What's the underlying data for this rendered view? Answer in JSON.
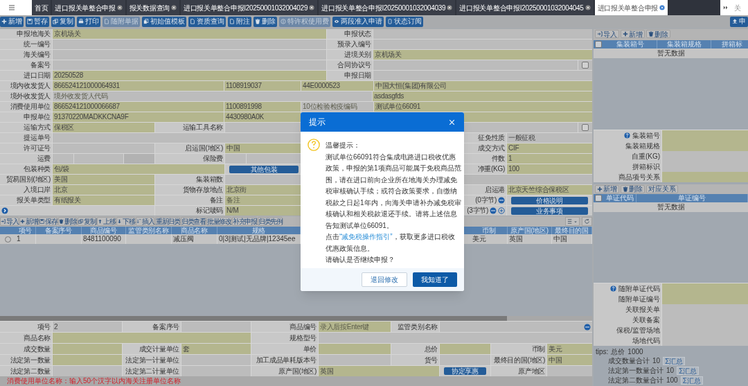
{
  "tabs": [
    {
      "label": "首页",
      "selected": false,
      "closable": false
    },
    {
      "label": "进口报关单整合申报",
      "selected": false,
      "closable": true
    },
    {
      "label": "报关数据查询",
      "selected": false,
      "closable": true
    },
    {
      "label": "进口报关单整合申报I20250001032004029",
      "selected": false,
      "closable": true
    },
    {
      "label": "进口报关单整合申报I20250001032004039",
      "selected": false,
      "closable": true
    },
    {
      "label": "进口报关单整合申报I20250001032004045",
      "selected": false,
      "closable": true
    },
    {
      "label": "进口报关单整合申报",
      "selected": true,
      "closable": true
    }
  ],
  "tab_overflow": {
    "label": "关"
  },
  "toolbar": [
    {
      "label": "新增",
      "disabled": false
    },
    {
      "label": "暂存",
      "disabled": false
    },
    {
      "label": "复制",
      "disabled": false
    },
    {
      "label": "打印",
      "disabled": false
    },
    {
      "label": "随附单据",
      "disabled": true
    },
    {
      "label": "初始值模板",
      "disabled": false
    },
    {
      "label": "资质查询",
      "disabled": false
    },
    {
      "label": "附注",
      "disabled": false
    },
    {
      "label": "删除",
      "disabled": false
    },
    {
      "label": "特许权使用费",
      "disabled": true
    },
    {
      "label": "两段准入申请",
      "disabled": false
    },
    {
      "label": "状态订阅",
      "disabled": false
    }
  ],
  "declare_button": {
    "label": "申"
  },
  "header_form": {
    "rows": [
      {
        "cells": [
          {
            "kind": "label",
            "text": "申报地海关"
          },
          {
            "kind": "field",
            "required": true,
            "value": "京机场关"
          },
          {
            "kind": "label",
            "text": "申报状态"
          },
          {
            "kind": "field",
            "required": false
          }
        ]
      },
      {
        "cells": [
          {
            "kind": "label",
            "text": "统一编号"
          },
          {
            "kind": "field",
            "required": false
          },
          {
            "kind": "label",
            "text": "预录入编号"
          },
          {
            "kind": "field",
            "required": false
          }
        ]
      },
      {
        "cells": [
          {
            "kind": "label",
            "text": "海关编号"
          },
          {
            "kind": "field",
            "required": false
          },
          {
            "kind": "label",
            "text": "进境关别"
          },
          {
            "kind": "field",
            "required": true,
            "value": "京机场关"
          }
        ]
      },
      {
        "cells": [
          {
            "kind": "label",
            "text": "备案号"
          },
          {
            "kind": "field",
            "required": false
          },
          {
            "kind": "label",
            "text": "合同协议号"
          },
          {
            "kind": "field",
            "required": false
          },
          {
            "kind": "checkbox",
            "checked": false
          }
        ]
      },
      {
        "cells": [
          {
            "kind": "label",
            "text": "进口日期"
          },
          {
            "kind": "field",
            "required": true,
            "value": "20250528"
          },
          {
            "kind": "label",
            "text": "申报日期"
          },
          {
            "kind": "field",
            "required": false
          }
        ]
      },
      {
        "cells": [
          {
            "kind": "label",
            "text": "境内收发货人"
          },
          {
            "kind": "field",
            "required": true,
            "value": "866524121000064931"
          },
          {
            "kind": "field",
            "required": true,
            "value": "1108919037"
          },
          {
            "kind": "field",
            "required": true,
            "value": "44E0000523"
          },
          {
            "kind": "field",
            "required": true,
            "value": "中国大恒(集团)有限公司"
          }
        ]
      },
      {
        "cells": [
          {
            "kind": "label",
            "text": "境外收发货人"
          },
          {
            "kind": "field",
            "required": false,
            "placeholder": "境外收发货人代码"
          },
          {
            "kind": "field",
            "required": true,
            "value": "asdasgfds"
          }
        ]
      },
      {
        "cells": [
          {
            "kind": "label",
            "text": "消费使用单位"
          },
          {
            "kind": "field",
            "required": true,
            "value": "866524121000066687"
          },
          {
            "kind": "field",
            "required": true,
            "value": "1100891998"
          },
          {
            "kind": "field",
            "required": false,
            "placeholder": "10位检验检疫编码"
          },
          {
            "kind": "field",
            "required": true,
            "value": "测试单位66091"
          }
        ]
      },
      {
        "cells": [
          {
            "kind": "label",
            "text": "申报单位"
          },
          {
            "kind": "field",
            "required": true,
            "value": "91370220MADKKCNA9F"
          },
          {
            "kind": "field",
            "required": true,
            "value": "4430980A0K"
          },
          {
            "kind": "field",
            "required": true
          }
        ]
      },
      {
        "cells": [
          {
            "kind": "label",
            "text": "运输方式"
          },
          {
            "kind": "field",
            "required": true,
            "value": "保税区"
          },
          {
            "kind": "label",
            "text": "运输工具名称"
          },
          {
            "kind": "field",
            "required": false
          },
          {
            "kind": "checkbox",
            "checked": false
          }
        ]
      },
      {
        "cells": [
          {
            "kind": "label",
            "text": "提运单号"
          },
          {
            "kind": "field",
            "required": false
          },
          {
            "kind": "merged"
          },
          {
            "kind": "merged"
          },
          {
            "kind": "label",
            "text": "征免性质"
          },
          {
            "kind": "field",
            "required": false,
            "value": "一般征税"
          }
        ]
      },
      {
        "cells": [
          {
            "kind": "label",
            "text": "许可证号"
          },
          {
            "kind": "field",
            "required": false
          },
          {
            "kind": "label",
            "text": "启运国(地区)"
          },
          {
            "kind": "field",
            "required": true,
            "value": "中国"
          },
          {
            "kind": "label",
            "text": "成交方式"
          },
          {
            "kind": "field",
            "required": true,
            "value": "CIF"
          }
        ]
      },
      {
        "cells": [
          {
            "kind": "label",
            "text": "运费"
          },
          {
            "kind": "money"
          },
          {
            "kind": "label",
            "text": "保险费"
          },
          {
            "kind": "money"
          },
          {
            "kind": "label",
            "text": "件数"
          },
          {
            "kind": "field",
            "required": true,
            "value": "1"
          }
        ]
      },
      {
        "cells": [
          {
            "kind": "label",
            "text": "包装种类"
          },
          {
            "kind": "field",
            "required": true,
            "value": "包/袋"
          },
          {
            "kind": "merged"
          },
          {
            "kind": "button",
            "text": "其他包装"
          },
          {
            "kind": "label",
            "text": "净重(KG)"
          },
          {
            "kind": "field",
            "required": true,
            "value": "100"
          }
        ]
      },
      {
        "cells": [
          {
            "kind": "label",
            "text": "贸易国别(地区)"
          },
          {
            "kind": "field",
            "required": true,
            "value": "美国"
          },
          {
            "kind": "label",
            "text": "集装箱数"
          },
          {
            "kind": "field",
            "required": false
          },
          {
            "kind": "blank"
          },
          {
            "kind": "merged"
          }
        ]
      },
      {
        "cells": [
          {
            "kind": "label",
            "text": "入境口岸"
          },
          {
            "kind": "field",
            "required": true,
            "value": "北京"
          },
          {
            "kind": "label",
            "text": "货物存放地点"
          },
          {
            "kind": "field",
            "required": true,
            "value": "北京街"
          },
          {
            "kind": "label",
            "text": "启运港"
          },
          {
            "kind": "field",
            "required": true,
            "value": "北京天竺综合保税区"
          }
        ]
      },
      {
        "cells": [
          {
            "kind": "label",
            "text": "报关单类型"
          },
          {
            "kind": "field",
            "required": true,
            "value": "有纸报关"
          },
          {
            "kind": "label",
            "text": "备注"
          },
          {
            "kind": "field",
            "required": true,
            "placeholder": "备注"
          },
          {
            "kind": "counter",
            "text": "(0字节)",
            "addable": false
          },
          {
            "kind": "button",
            "text": "价格说明"
          }
        ]
      },
      {
        "cells": [
          {
            "kind": "expand"
          },
          {
            "kind": "merged"
          },
          {
            "kind": "label",
            "text": "标记唛码"
          },
          {
            "kind": "field",
            "required": true,
            "value": "N/M"
          },
          {
            "kind": "counter",
            "text": "(3字节)",
            "addable": true
          },
          {
            "kind": "button",
            "text": "业务事项"
          }
        ]
      }
    ]
  },
  "goods_toolbar": [
    {
      "label": "导入"
    },
    {
      "label": "新增"
    },
    {
      "label": "保存"
    },
    {
      "label": "删除"
    },
    {
      "label": "复制"
    },
    {
      "label": "上移"
    },
    {
      "label": "下移"
    },
    {
      "label": "插入"
    },
    {
      "label": "重新归类"
    },
    {
      "label": "归类查看"
    },
    {
      "label": "批量修改"
    },
    {
      "label": "补充申报"
    },
    {
      "label": "归类先例"
    }
  ],
  "goods_table": {
    "columns": [
      "项号",
      "备案序号",
      "商品编号",
      "监管类别名称",
      "商品名称",
      "规格",
      "币制",
      "原产国(地区)",
      "最终目的国"
    ],
    "rows": [
      {
        "selected": false,
        "item_no": "1",
        "hs_code": "8481100090",
        "name": "减压阀",
        "spec": "0|3|测试|无品牌|12345ee",
        "currency": "美元",
        "origin": "英国",
        "destination": "中国"
      }
    ]
  },
  "goods_form": {
    "rows": [
      {
        "cells": [
          {
            "kind": "label",
            "text": "项号"
          },
          {
            "kind": "field",
            "required": false,
            "value": "2"
          },
          {
            "kind": "label",
            "text": "备案序号"
          },
          {
            "kind": "field",
            "required": false
          },
          {
            "kind": "label",
            "text": "商品编号"
          },
          {
            "kind": "field",
            "required": true,
            "placeholder": "录入后按Enter键"
          },
          {
            "kind": "label",
            "text": "监管类别名称"
          },
          {
            "kind": "lookup",
            "required": false
          }
        ]
      },
      {
        "cells": [
          {
            "kind": "label",
            "text": "商品名称"
          },
          {
            "kind": "field",
            "required": true
          },
          {
            "kind": "merged"
          },
          {
            "kind": "merged"
          },
          {
            "kind": "label",
            "text": "规格型号"
          },
          {
            "kind": "field",
            "required": false
          },
          {
            "kind": "merged"
          },
          {
            "kind": "merged"
          },
          {
            "kind": "merged"
          },
          {
            "kind": "merged"
          }
        ]
      },
      {
        "cells": [
          {
            "kind": "label",
            "text": "成交数量"
          },
          {
            "kind": "field",
            "required": true
          },
          {
            "kind": "label",
            "text": "成交计量单位"
          },
          {
            "kind": "field",
            "required": true,
            "value": "套"
          },
          {
            "kind": "label",
            "text": "单价"
          },
          {
            "kind": "field",
            "required": true
          },
          {
            "kind": "label",
            "text": "总价"
          },
          {
            "kind": "field",
            "required": true
          },
          {
            "kind": "label",
            "text": "币制"
          },
          {
            "kind": "field",
            "required": true,
            "value": "美元"
          }
        ]
      },
      {
        "cells": [
          {
            "kind": "label",
            "text": "法定第一数量"
          },
          {
            "kind": "field",
            "required": true
          },
          {
            "kind": "label",
            "text": "法定第一计量单位"
          },
          {
            "kind": "field",
            "required": false
          },
          {
            "kind": "label",
            "text": "加工成品单耗版本号"
          },
          {
            "kind": "field",
            "required": false
          },
          {
            "kind": "label",
            "text": "货号"
          },
          {
            "kind": "field",
            "required": false
          },
          {
            "kind": "label",
            "text": "最终目的国(地区)"
          },
          {
            "kind": "field",
            "required": true,
            "value": "中国"
          }
        ]
      },
      {
        "cells": [
          {
            "kind": "label",
            "text": "法定第二数量"
          },
          {
            "kind": "field",
            "required": false
          },
          {
            "kind": "label",
            "text": "法定第二计量单位"
          },
          {
            "kind": "field",
            "required": false
          },
          {
            "kind": "label",
            "text": "原产国(地区)"
          },
          {
            "kind": "field",
            "required": true,
            "value": "英国"
          },
          {
            "kind": "merged"
          },
          {
            "kind": "button",
            "text": "协定享惠"
          },
          {
            "kind": "label",
            "text": "原产地区"
          },
          {
            "kind": "field",
            "required": false
          }
        ]
      }
    ]
  },
  "hint": "消费使用单位名称：输入50个汉字以内海关注册单位名称",
  "container_toolbar": [
    {
      "label": "导入"
    },
    {
      "label": "新增"
    },
    {
      "label": "删除"
    }
  ],
  "container_table": {
    "all_checked": false,
    "columns": [
      "集装箱号",
      "集装箱规格",
      "拼箱标"
    ],
    "empty": "暂无数据"
  },
  "container_fields": [
    {
      "label": "集装箱号",
      "help": true,
      "required": true
    },
    {
      "label": "集装箱规格",
      "help": false,
      "required": true
    },
    {
      "label": "自重(KG)",
      "help": false,
      "required": false
    },
    {
      "label": "拼箱标识",
      "help": false,
      "required": false
    },
    {
      "label": "商品项号关系",
      "help": false,
      "required": true
    }
  ],
  "document_toolbar": [
    {
      "label": "新增"
    },
    {
      "label": "删除"
    },
    {
      "label": "对应关系"
    }
  ],
  "document_table": {
    "all_checked": false,
    "columns": [
      "单证代码",
      "单证编号"
    ],
    "empty": "暂无数据"
  },
  "document_fields": [
    {
      "label": "随附单证代码",
      "help": true,
      "required": true
    },
    {
      "label": "随附单证编号",
      "help": false,
      "required": true
    },
    {
      "label": "关联报关单",
      "help": false,
      "required": false
    },
    {
      "label": "关联备案",
      "help": false,
      "required": false
    },
    {
      "label": "保税/监管场地",
      "help": false,
      "required": false
    },
    {
      "label": "场地代码",
      "help": false,
      "required": false
    }
  ],
  "tips": {
    "prefix": "tips:",
    "total_label": "总价",
    "total_value": "1000",
    "sums": [
      {
        "label": "成交数量合计",
        "value": "10",
        "button": "Σ汇总"
      },
      {
        "label": "法定第一数量合计",
        "value": "10",
        "button": "Σ汇总"
      },
      {
        "label": "法定第二数量合计",
        "value": "100",
        "button": "Σ汇总"
      }
    ]
  },
  "dialog": {
    "title": "提示",
    "greeting": "温馨提示：",
    "message": "测试单位66091符合集成电路进口税收优惠政策，申报的第1项商品可能属于免税商品范围，请在进口前向企业所在地海关办理减免税审核确认手续；或符合政策要求，自缴纳税款之日起1年内，向海关申请补办减免税审核确认和相关税款退还手续。请将上述信息告知测试单位66091。",
    "guide_before": "点击",
    "guide_link": "“减免税操作指引”",
    "guide_after": "，获取更多进口税收优惠政策信息。",
    "question": "请确认是否继续申报？",
    "buttons": [
      {
        "label": "退回修改",
        "primary": false
      },
      {
        "label": "我知道了",
        "primary": true
      }
    ]
  }
}
